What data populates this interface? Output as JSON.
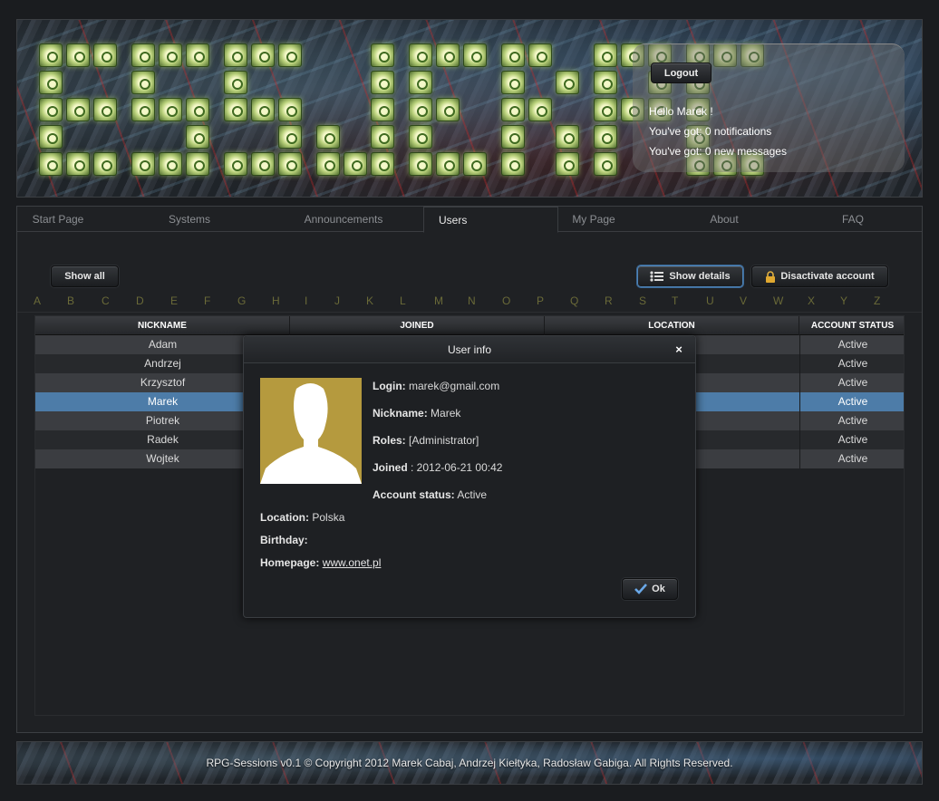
{
  "header": {
    "logout_label": "Logout",
    "greeting": "Hello Marek !",
    "notifications": "You've got: 0 notifications",
    "messages": "You've got: 0 new messages"
  },
  "tabs": [
    {
      "label": "Start Page"
    },
    {
      "label": "Systems"
    },
    {
      "label": "Announcements"
    },
    {
      "label": "Users"
    },
    {
      "label": "My Page"
    },
    {
      "label": "About"
    },
    {
      "label": "FAQ"
    }
  ],
  "active_tab": "Users",
  "toolbar": {
    "show_all": "Show all",
    "show_details": "Show details",
    "deactivate": "Disactivate account"
  },
  "alphabet": [
    "A",
    "B",
    "C",
    "D",
    "E",
    "F",
    "G",
    "H",
    "I",
    "J",
    "K",
    "L",
    "M",
    "N",
    "O",
    "P",
    "Q",
    "R",
    "S",
    "T",
    "U",
    "V",
    "W",
    "X",
    "Y",
    "Z"
  ],
  "grid": {
    "columns": [
      "NICKNAME",
      "JOINED",
      "LOCATION",
      "ACCOUNT STATUS"
    ],
    "rows": [
      {
        "nickname": "Adam",
        "status": "Active"
      },
      {
        "nickname": "Andrzej",
        "status": "Active"
      },
      {
        "nickname": "Krzysztof",
        "status": "Active"
      },
      {
        "nickname": "Marek",
        "status": "Active",
        "selected": true
      },
      {
        "nickname": "Piotrek",
        "status": "Active"
      },
      {
        "nickname": "Radek",
        "status": "Active"
      },
      {
        "nickname": "Wojtek",
        "status": "Active"
      }
    ]
  },
  "dialog": {
    "title": "User info",
    "close": "×",
    "login_label": "Login:",
    "login_value": "marek@gmail.com",
    "nickname_label": "Nickname:",
    "nickname_value": "Marek",
    "roles_label": "Roles:",
    "roles_value": "[Administrator]",
    "joined_label": "Joined",
    "joined_value": ": 2012-06-21 00:42",
    "status_label": "Account status:",
    "status_value": "Active",
    "location_label": "Location:",
    "location_value": "Polska",
    "birthday_label": "Birthday:",
    "birthday_value": "",
    "homepage_label": "Homepage:",
    "homepage_value": "www.onet.pl",
    "ok_label": "Ok"
  },
  "footer": {
    "text": "RPG-Sessions v0.1 © Copyright 2012  Marek Cabaj, Andrzej Kiełtyka, Radosław Gabiga. All Rights Reserved."
  },
  "colors": {
    "selected_row": "#4d7ca8",
    "avatar_bg": "#b59a3e",
    "alphabet": "#6a6a38"
  }
}
